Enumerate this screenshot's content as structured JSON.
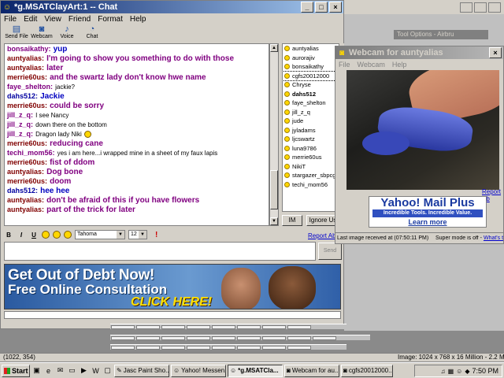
{
  "chat_window": {
    "title": "*g.MSATClayArt:1 -- Chat",
    "menu": [
      "File",
      "Edit",
      "View",
      "Friend",
      "Format",
      "Help"
    ],
    "toolbar": [
      "Send File",
      "Webcam",
      "Voice",
      "Chat"
    ],
    "log": [
      {
        "nick": "bonsaikathy:",
        "text": "yup",
        "nick_color": "#800080",
        "text_color": "#0000c0",
        "size": "lg"
      },
      {
        "nick": "auntyalias:",
        "text": "I'm going to show you something to do with those",
        "nick_color": "#800000",
        "text_color": "#800080",
        "size": "lg"
      },
      {
        "nick": "auntyalias:",
        "text": "later",
        "nick_color": "#800000",
        "text_color": "#800080",
        "size": "lg"
      },
      {
        "nick": "merrie60us:",
        "text": "and the swartz lady don't know hwe name",
        "nick_color": "#800000",
        "text_color": "#800080",
        "size": "lg"
      },
      {
        "nick": "faye_shelton:",
        "text": "jackie?",
        "nick_color": "#800080",
        "text_color": "#000000",
        "size": "sm"
      },
      {
        "nick": "dahs512:",
        "text": "Jackie",
        "nick_color": "#0000a0",
        "text_color": "#0000c0",
        "size": "lg"
      },
      {
        "nick": "merrie60us:",
        "text": "could be sorry",
        "nick_color": "#800000",
        "text_color": "#800080",
        "size": "lg"
      },
      {
        "nick": "jill_z_q:",
        "text": "I see Nancy",
        "nick_color": "#800080",
        "text_color": "#000000",
        "size": "sm"
      },
      {
        "nick": "jill_z_q:",
        "text": "down there on the bottom",
        "nick_color": "#800080",
        "text_color": "#000000",
        "size": "sm"
      },
      {
        "nick": "jill_z_q:",
        "text": "Dragon lady Niki",
        "nick_color": "#800080",
        "text_color": "#000000",
        "size": "sm",
        "emoticon": true
      },
      {
        "nick": "merrie60us:",
        "text": "reducing cane",
        "nick_color": "#800000",
        "text_color": "#800080",
        "size": "lg"
      },
      {
        "nick": "techi_mom56:",
        "text": "yes i am here...i wrapped mine in a sheet of my faux lapis",
        "nick_color": "#800080",
        "text_color": "#000000",
        "size": "sm"
      },
      {
        "nick": "merrie60us:",
        "text": "fist of ddom",
        "nick_color": "#800000",
        "text_color": "#800080",
        "size": "lg"
      },
      {
        "nick": "auntyalias:",
        "text": "Dog bone",
        "nick_color": "#800000",
        "text_color": "#800080",
        "size": "lg"
      },
      {
        "nick": "merrie60us:",
        "text": "doom",
        "nick_color": "#800000",
        "text_color": "#800080",
        "size": "lg"
      },
      {
        "nick": "dahs512:",
        "text": "hee hee",
        "nick_color": "#0000a0",
        "text_color": "#0000c0",
        "size": "lg"
      },
      {
        "nick": "auntyalias:",
        "text": "don't be afraid of this if you have flowers",
        "nick_color": "#800000",
        "text_color": "#800080",
        "size": "lg"
      },
      {
        "nick": "auntyalias:",
        "text": "part of the trick for later",
        "nick_color": "#800000",
        "text_color": "#800080",
        "size": "lg"
      }
    ],
    "users": [
      {
        "name": "auntyalias",
        "bold": false
      },
      {
        "name": "aurorajiv",
        "bold": false
      },
      {
        "name": "bonsaikathy",
        "bold": false
      },
      {
        "name": "cgfs20012000",
        "bold": false,
        "selected": true
      },
      {
        "name": "Chryse",
        "bold": false
      },
      {
        "name": "dahs512",
        "bold": true
      },
      {
        "name": "faye_shelton",
        "bold": false
      },
      {
        "name": "jill_z_q",
        "bold": false
      },
      {
        "name": "jude",
        "bold": false
      },
      {
        "name": "jyladams",
        "bold": false
      },
      {
        "name": "ljcswartz",
        "bold": false
      },
      {
        "name": "luna9786",
        "bold": false
      },
      {
        "name": "merrie60us",
        "bold": false
      },
      {
        "name": "NikiT",
        "bold": false
      },
      {
        "name": "stargazer_sbpcg",
        "bold": false
      },
      {
        "name": "techi_mom56",
        "bold": false
      }
    ],
    "im_button": "IM",
    "ignore_button": "Ignore Us",
    "report_abuse": "Report Abu",
    "format": {
      "font": "Tahoma",
      "size": "12"
    },
    "send_button": "Send",
    "ad": {
      "line1": "Get Out of Debt Now!",
      "line2": "Free Online Consultation",
      "line3": "CLICK HERE!"
    }
  },
  "background": {
    "tool_options": "Tool Options - Airbru"
  },
  "webcam_window": {
    "title": "Webcam for auntyalias",
    "menu": [
      "File",
      "Webcam",
      "Help"
    ],
    "report_abuse": "Report Ab",
    "ad": {
      "line1": "Yahoo! Mail Plus",
      "line2": "Incredible Tools. Incredible Value.",
      "line3": "Learn more"
    },
    "status_left": "Last image received at (07:50:11 PM)",
    "status_right_prefix": "Super mode is off - ",
    "status_right_link": "What's t"
  },
  "image_status": {
    "coords": "(1022, 354)",
    "info": "Image:  1024 x 768 x 16 Million - 2.2 MBytes"
  },
  "taskbar": {
    "start": "Start",
    "tasks": [
      "Jasc Paint Sho...",
      "Yahoo! Messen...",
      "*g.MSATCla...",
      "Webcam for au...",
      "cgfs20012000..."
    ],
    "active_task": 2,
    "clock": "7:50 PM"
  }
}
